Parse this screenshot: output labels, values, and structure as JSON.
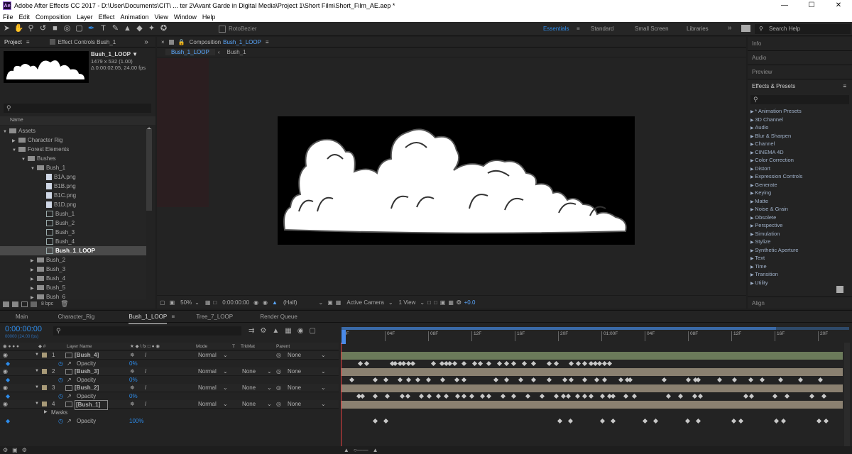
{
  "app": {
    "title": "Adobe After Effects CC 2017 - D:\\User\\Documents\\CIT\\ ... ter 2\\Avant Garde in Digital Media\\Project 1\\Short Film\\Short_Film_AE.aep *",
    "logo": "Ae"
  },
  "menu": [
    "File",
    "Edit",
    "Composition",
    "Layer",
    "Effect",
    "Animation",
    "View",
    "Window",
    "Help"
  ],
  "toolbar": {
    "rotobezier": "RotoBezier",
    "workspaces": [
      "Essentials",
      "Standard",
      "Small Screen",
      "Libraries"
    ],
    "search_help": "Search Help"
  },
  "project": {
    "tab_project": "Project",
    "tab_effect_controls": "Effect Controls Bush_1",
    "item_name": "Bush_1_LOOP ▼",
    "item_size": "1479 x 532 (1.00)",
    "item_duration": "Δ 0:00:02:05, 24.00 fps",
    "col_name": "Name",
    "bpc": "8 bpc",
    "tree": [
      {
        "label": "Assets",
        "indent": 0,
        "type": "folder",
        "arrow": "▼"
      },
      {
        "label": "Character Rig",
        "indent": 1,
        "type": "folder",
        "arrow": "▶"
      },
      {
        "label": "Forest Elements",
        "indent": 1,
        "type": "folder",
        "arrow": "▼"
      },
      {
        "label": "Bushes",
        "indent": 2,
        "type": "folder",
        "arrow": "▼"
      },
      {
        "label": "Bush_1",
        "indent": 3,
        "type": "folder",
        "arrow": "▼"
      },
      {
        "label": "B1A.png",
        "indent": 4,
        "type": "file",
        "arrow": ""
      },
      {
        "label": "B1B.png",
        "indent": 4,
        "type": "file",
        "arrow": ""
      },
      {
        "label": "B1C.png",
        "indent": 4,
        "type": "file",
        "arrow": ""
      },
      {
        "label": "B1D.png",
        "indent": 4,
        "type": "file",
        "arrow": ""
      },
      {
        "label": "Bush_1",
        "indent": 4,
        "type": "comp",
        "arrow": ""
      },
      {
        "label": "Bush_2",
        "indent": 4,
        "type": "comp",
        "arrow": ""
      },
      {
        "label": "Bush_3",
        "indent": 4,
        "type": "comp",
        "arrow": ""
      },
      {
        "label": "Bush_4",
        "indent": 4,
        "type": "comp",
        "arrow": ""
      },
      {
        "label": "Bush_1_LOOP",
        "indent": 4,
        "type": "comp",
        "arrow": "",
        "selected": true
      },
      {
        "label": "Bush_2",
        "indent": 3,
        "type": "folder",
        "arrow": "▶"
      },
      {
        "label": "Bush_3",
        "indent": 3,
        "type": "folder",
        "arrow": "▶"
      },
      {
        "label": "Bush_4",
        "indent": 3,
        "type": "folder",
        "arrow": "▶"
      },
      {
        "label": "Bush_5",
        "indent": 3,
        "type": "folder",
        "arrow": "▶"
      },
      {
        "label": "Bush_6",
        "indent": 3,
        "type": "folder",
        "arrow": "▶"
      }
    ]
  },
  "composition": {
    "panel_label": "Composition",
    "comp_name": "Bush_1_LOOP",
    "breadcrumb": [
      "Bush_1_LOOP",
      "Bush_1"
    ],
    "zoom": "50%",
    "timecode": "0:00:00:00",
    "resolution": "(Half)",
    "camera": "Active Camera",
    "views": "1 View",
    "exposure": "+0.0"
  },
  "effects": {
    "info": "Info",
    "audio": "Audio",
    "preview": "Preview",
    "title": "Effects & Presets",
    "align": "Align",
    "items": [
      "* Animation Presets",
      "3D Channel",
      "Audio",
      "Blur & Sharpen",
      "Channel",
      "CINEMA 4D",
      "Color Correction",
      "Distort",
      "Expression Controls",
      "Generate",
      "Keying",
      "Matte",
      "Noise & Grain",
      "Obsolete",
      "Perspective",
      "Simulation",
      "Stylize",
      "Synthetic Aperture",
      "Text",
      "Time",
      "Transition",
      "Utility"
    ]
  },
  "timeline": {
    "tabs": [
      "Main",
      "Character_Rig",
      "Bush_1_LOOP",
      "Tree_7_LOOP",
      "Render Queue"
    ],
    "timecode": "0:00:00:00",
    "timecode_sub": "00000 (24.00 fps)",
    "col_layer_name": "Layer Name",
    "col_mode": "Mode",
    "col_t": "T",
    "col_trkmat": "TrkMat",
    "col_parent": "Parent",
    "ruler": [
      "0F",
      "04F",
      "08F",
      "12F",
      "16F",
      "20F",
      "01:00F",
      "04F",
      "08F",
      "12F",
      "16F",
      "20F"
    ],
    "layers": [
      {
        "num": "1",
        "name": "[Bush_4]",
        "mode": "Normal",
        "trkmat": "",
        "parent": "None",
        "prop": "Opacity",
        "value": "0%",
        "keys": [
          24,
          33,
          69,
          73,
          80,
          85,
          92,
          98,
          127,
          139,
          145,
          150,
          157,
          170,
          185,
          193,
          205,
          220,
          230,
          240,
          255,
          268,
          290,
          300,
          321,
          331,
          340,
          349,
          355,
          361,
          368,
          375
        ]
      },
      {
        "num": "2",
        "name": "[Bush_3]",
        "mode": "Normal",
        "trkmat": "None",
        "parent": "None",
        "prop": "Opacity",
        "value": "0%",
        "keys": [
          12,
          45,
          60,
          80,
          92,
          105,
          120,
          140,
          160,
          170,
          215,
          230,
          250,
          268,
          290,
          312,
          321,
          340,
          357,
          368,
          391,
          400,
          404,
          452,
          486,
          496,
          500,
          530,
          551,
          574,
          590,
          616,
          644,
          672
        ]
      },
      {
        "num": "3",
        "name": "[Bush_2]",
        "mode": "Normal",
        "trkmat": "None",
        "parent": "None",
        "prop": "Opacity",
        "value": "0%",
        "keys": [
          22,
          27,
          45,
          62,
          83,
          91,
          110,
          121,
          134,
          145,
          161,
          170,
          181,
          196,
          205,
          225,
          240,
          260,
          280,
          300,
          310,
          317,
          330,
          340,
          349,
          365,
          375,
          380,
          398,
          410,
          458,
          475,
          495,
          503,
          567,
          575,
          608,
          625,
          660,
          677
        ]
      },
      {
        "num": "4",
        "name": "[Bush_1]",
        "mode": "Normal",
        "trkmat": "None",
        "parent": "None",
        "prop": "Opacity",
        "value": "100%",
        "keys": [
          45,
          60,
          305,
          320,
          365,
          380,
          425,
          440,
          485,
          500,
          550,
          560,
          610,
          620,
          670,
          680
        ]
      }
    ],
    "masks": "Masks"
  }
}
